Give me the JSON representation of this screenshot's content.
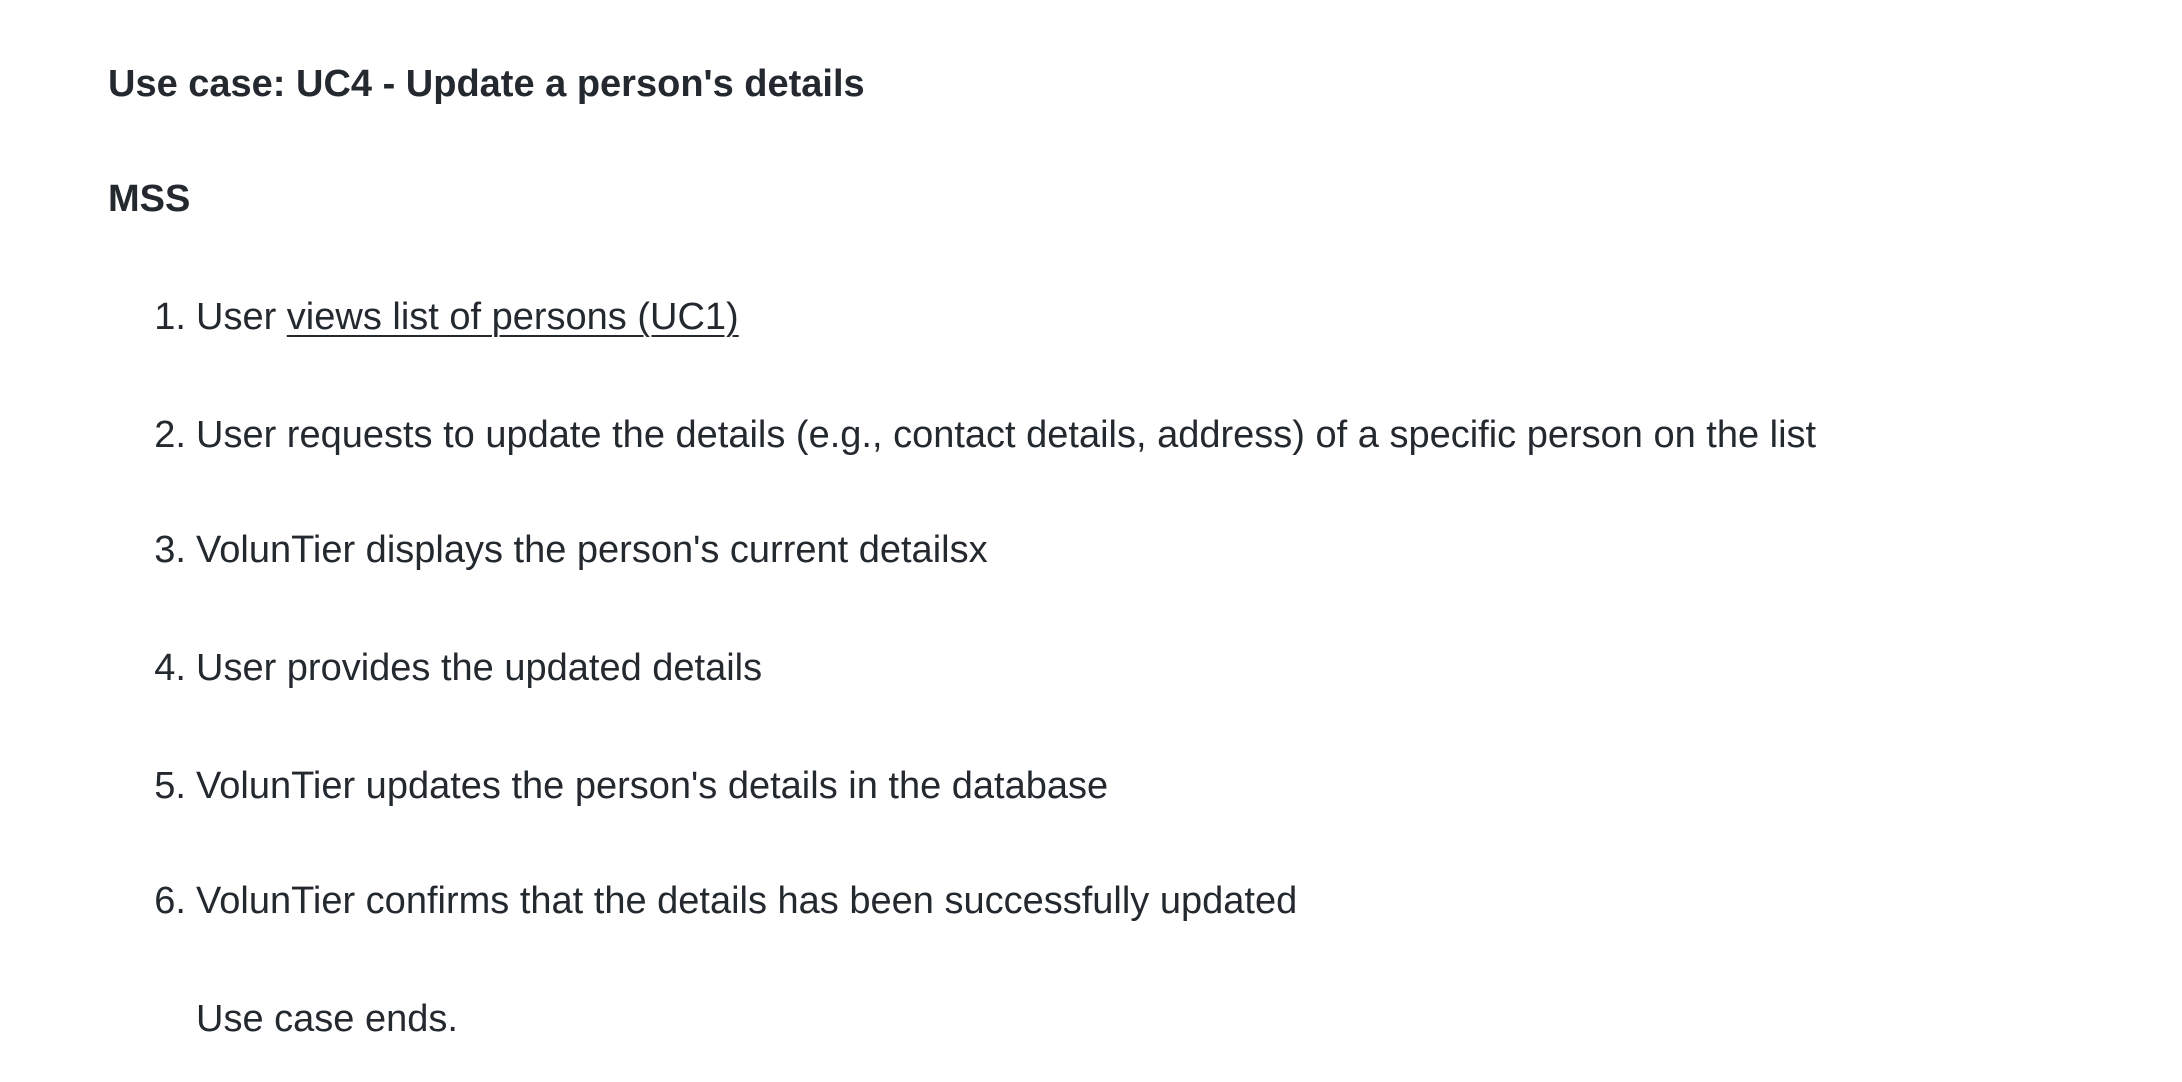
{
  "use_case_title": "Use case: UC4 - Update a person's details",
  "mss_heading": "MSS",
  "steps": [
    {
      "number": "1.",
      "prefix": "User ",
      "link_text": "views list of persons (UC1)"
    },
    {
      "number": "2.",
      "text": "User requests to update the details (e.g., contact details, address) of a specific person on the list"
    },
    {
      "number": "3.",
      "text": "VolunTier displays the person's current detailsx"
    },
    {
      "number": "4.",
      "text": "User provides the updated details"
    },
    {
      "number": "5.",
      "text": "VolunTier updates the person's details in the database"
    },
    {
      "number": "6.",
      "text": "VolunTier confirms that the details has been successfully updated"
    }
  ],
  "ending": "Use case ends."
}
